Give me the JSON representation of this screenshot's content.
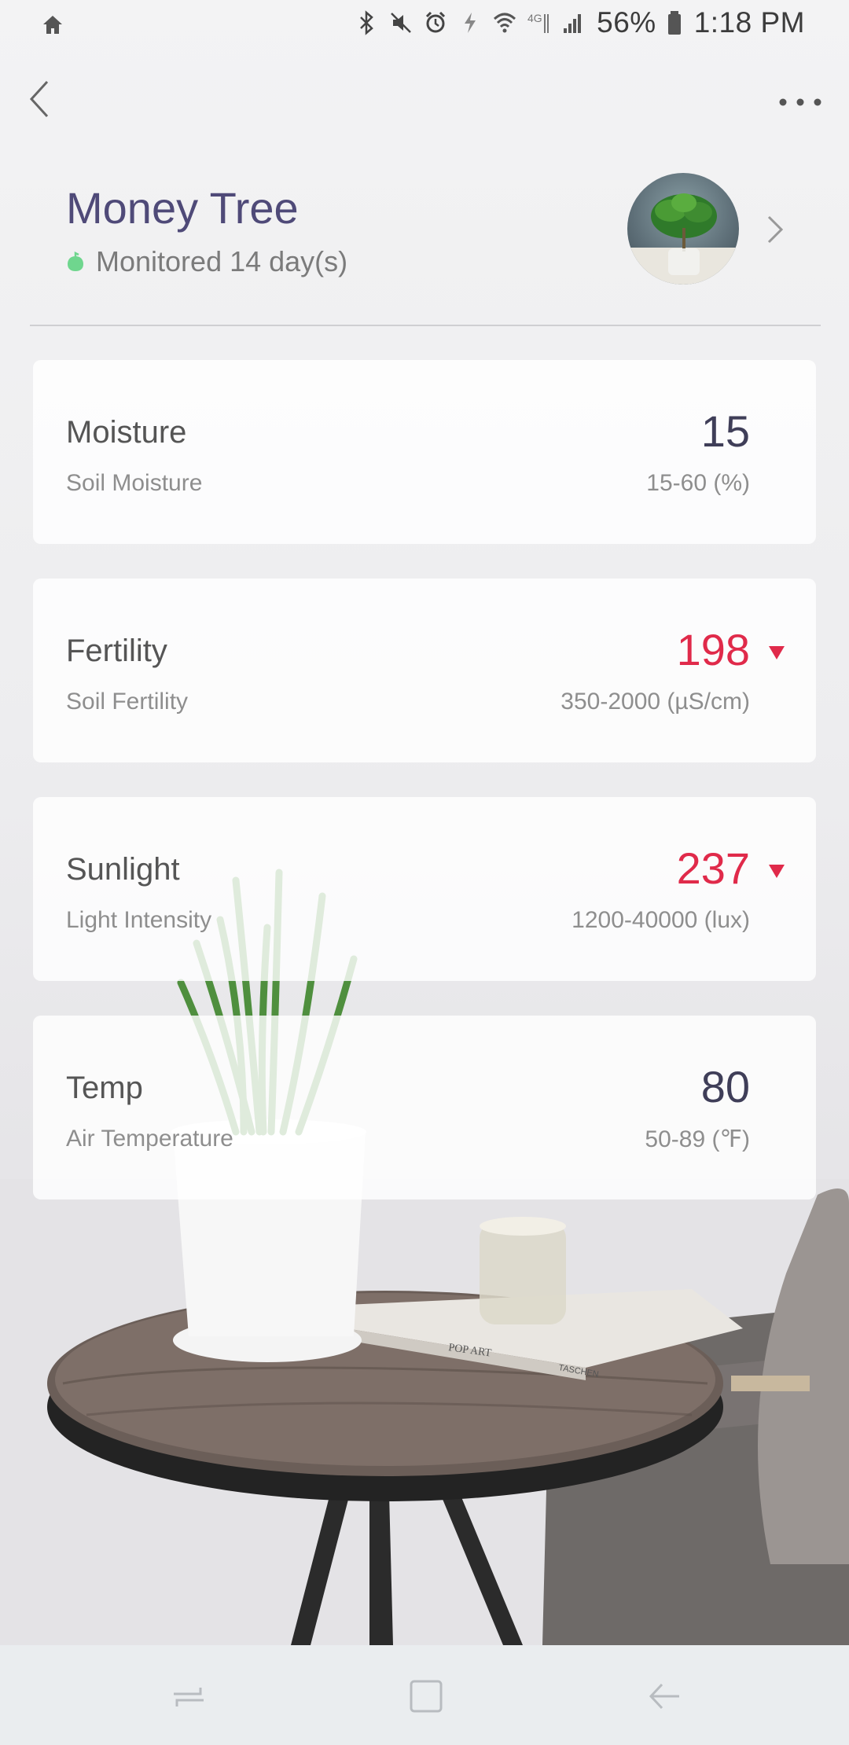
{
  "status_bar": {
    "battery": "56%",
    "time": "1:18 PM",
    "icons": [
      "home-icon",
      "bluetooth-icon",
      "mute-icon",
      "alarm-icon",
      "charging-icon",
      "wifi-icon",
      "lte-icon",
      "signal-icon",
      "battery-icon"
    ]
  },
  "header": {
    "title": "Money Tree",
    "monitored": "Monitored 14 day(s)"
  },
  "metrics": [
    {
      "title": "Moisture",
      "subtitle": "Soil Moisture",
      "value": "15",
      "range": "15-60 (%)",
      "alert": false
    },
    {
      "title": "Fertility",
      "subtitle": "Soil Fertility",
      "value": "198",
      "range": "350-2000 (µS/cm)",
      "alert": true
    },
    {
      "title": "Sunlight",
      "subtitle": "Light Intensity",
      "value": "237",
      "range": "1200-40000 (lux)",
      "alert": true
    },
    {
      "title": "Temp",
      "subtitle": "Air Temperature",
      "value": "80",
      "range": "50-89 (℉)",
      "alert": false
    }
  ],
  "colors": {
    "title": "#4f4a78",
    "normal_value": "#3f3e58",
    "alert_value": "#e02a4a",
    "leaf": "#6fd68e"
  },
  "scene": {
    "book_text_1": "POP ART",
    "book_text_2": "TASCHEN"
  }
}
